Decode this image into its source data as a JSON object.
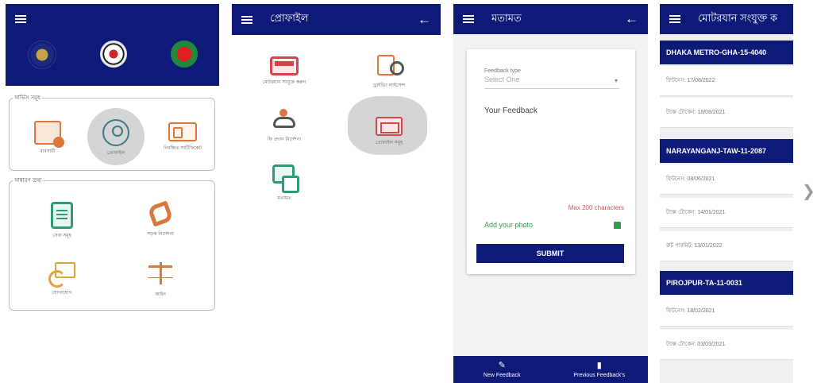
{
  "screen1": {
    "logos": [
      "police-logo",
      "brta-logo",
      "govt-bangladesh-logo"
    ],
    "section1_label": "সার্ভিস সমূহ",
    "services": [
      "ব্যবসায়ী",
      "প্রোফাইল",
      "নিবন্ধিত সার্টিফিকেট"
    ],
    "section2_label": "সাধারণ তথ্য",
    "general": [
      "সেবা সমূহ",
      "সড়ক নির্দেশনা",
      "যোগাযোগ",
      "আইন"
    ]
  },
  "screen2": {
    "title": "প্রোফাইল",
    "tiles": [
      "মোটরযান সংযুক্ত করুন",
      "ড্রাইভিং লাইসেন্স",
      "ফি প্রদান নির্দেশনা",
      "প্রোফাইল সমূহ",
      "মতামত"
    ]
  },
  "screen3": {
    "title": "মতামত",
    "feedback_type_label": "Feedback type",
    "feedback_type_placeholder": "Select One",
    "feedback_placeholder": "Your Feedback",
    "max_chars": "Max 200 characters",
    "add_photo": "Add your photo",
    "submit": "SUBMIT",
    "nav": [
      "New Feedback",
      "Previous Feedback's"
    ]
  },
  "screen4": {
    "title": "মোটরযান সংযুক্ত ক",
    "vehicles": [
      {
        "plate": "DHAKA METRO-GHA-15-4040",
        "rows": [
          "ফিটনেস: 17/08/2022",
          "ট্যাক্স টোকেন: 18/08/2021"
        ]
      },
      {
        "plate": "NARAYANGANJ-TAW-11-2087",
        "rows": [
          "ফিটনেস: 08/06/2021",
          "ট্যাক্স টোকেন: 14/01/2021",
          "রুট পারমিট: 13/01/2022"
        ]
      },
      {
        "plate": "PIROJPUR-TA-11-0031",
        "rows": [
          "ফিটনেস: 18/02/2021",
          "ট্যাক্স টোকেন: 03/03/2021"
        ]
      }
    ]
  },
  "colors": {
    "primary": "#0d1a78",
    "accent_orange": "#d9783c",
    "accent_green": "#2e9b77",
    "error": "#d9534f"
  }
}
